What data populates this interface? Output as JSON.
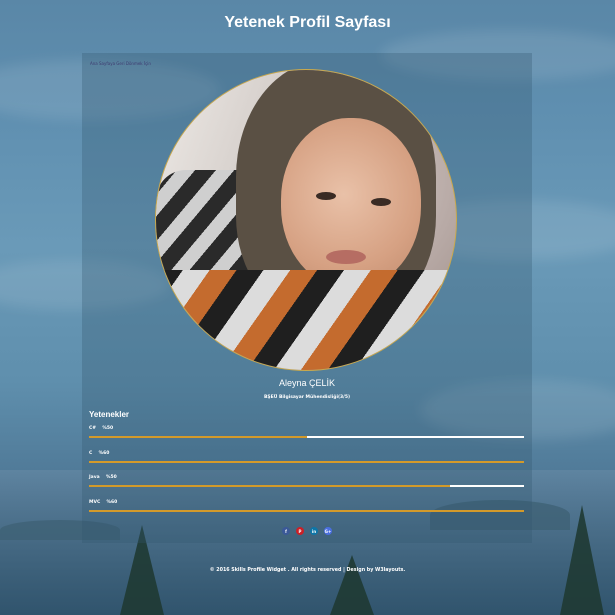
{
  "page": {
    "title": "Yetenek Profil Sayfası"
  },
  "breadcrumb": "Ana Sayfaya Geri Dönmek İçin",
  "profile": {
    "name": "Aleyna ÇELİK",
    "subtitle": "BŞEÜ Bilgisayar Mühendisliği(3/5)"
  },
  "skills": {
    "heading": "Yetenekler",
    "items": [
      {
        "label": "C#    %50",
        "percent": 50
      },
      {
        "label": "C    %60",
        "percent": 100
      },
      {
        "label": "Java    %50",
        "percent": 83
      },
      {
        "label": "MVC    %60",
        "percent": 100
      }
    ]
  },
  "socials": [
    {
      "icon": "facebook-icon",
      "glyph": "f",
      "color": "#3b5998"
    },
    {
      "icon": "pinterest-icon",
      "glyph": "P",
      "color": "#cb2027"
    },
    {
      "icon": "linkedin-icon",
      "glyph": "in",
      "color": "#0e76a8"
    },
    {
      "icon": "google-plus-icon",
      "glyph": "G+",
      "color": "#4a6fe0"
    }
  ],
  "footer": "© 2016 Skills Profile Widget . All rights reserved | Design by W3layouts.",
  "colors": {
    "accent": "#d39a2a",
    "avatar_border": "#c9a94d"
  }
}
